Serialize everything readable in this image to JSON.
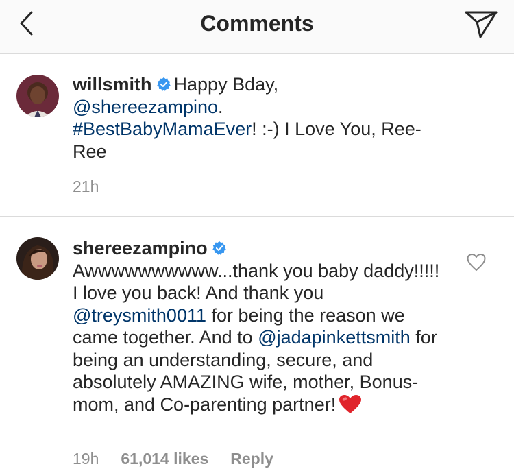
{
  "header": {
    "title": "Comments",
    "back_icon": "chevron-left-icon",
    "share_icon": "paper-plane-icon"
  },
  "comments": [
    {
      "username": "willsmith",
      "verified": true,
      "text_parts": {
        "a": "Happy Bday,",
        "mention": "@shereezampino",
        "b": ".",
        "hashtag": "#BestBabyMamaEver",
        "c": "! :-) I Love You, Ree-Ree"
      },
      "time": "21h"
    },
    {
      "username": "shereezampino",
      "verified": true,
      "text_parts": {
        "a": "Awwwwwwwwww...thank you baby daddy!!!!! I love you back! And thank you",
        "mention1": "@treysmith0011",
        "b": "for being the reason we came together. And to",
        "mention2": "@jadapinkettsmith",
        "c": "for being an understanding, secure, and absolutely AMAZING wife, mother, Bonus-mom, and Co-parenting partner!"
      },
      "time": "19h",
      "likes": "61,014 likes",
      "reply_label": "Reply",
      "like_icon": "heart-outline-icon",
      "emoji": "red-heart-emoji"
    }
  ],
  "colors": {
    "header_bg": "#fafafa",
    "text": "#262626",
    "link": "#003569",
    "secondary": "#8e8e8e",
    "divider": "#dbdbdb",
    "verified": "#3897f0",
    "heart": "#e0242b"
  }
}
